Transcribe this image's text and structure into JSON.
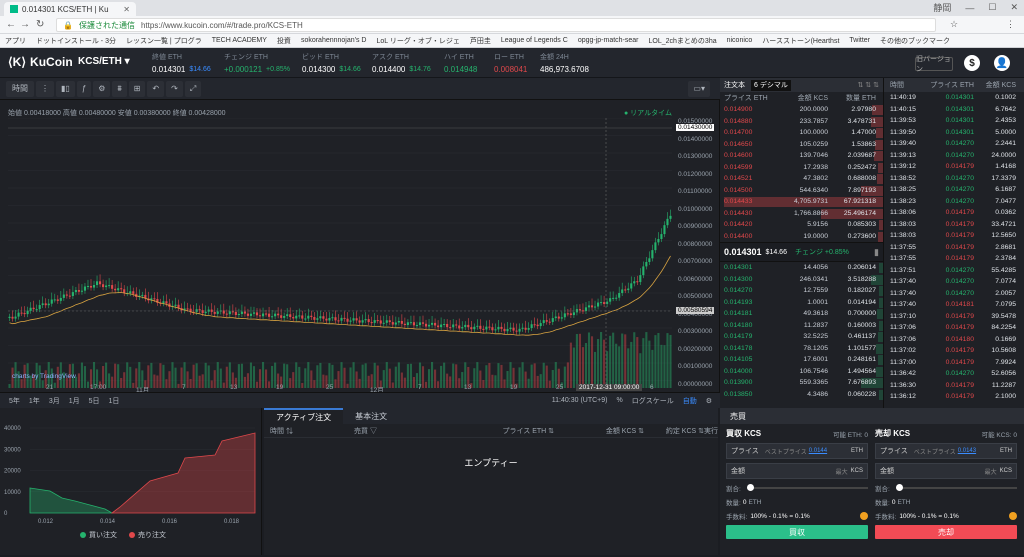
{
  "browser": {
    "tab_title": "0.014301 KCS/ETH | Ku",
    "user": "静岡",
    "url_secure": "保護された通信",
    "url": "https://www.kucoin.com/#/trade.pro/KCS-ETH",
    "bookmarks": [
      "アプリ",
      "ドットインストール - 3分",
      "レッスン一覧 | プログラ",
      "TECH ACADEMY",
      "投資",
      "sokorahennnojan's D",
      "LoL リーグ・オブ・レジェ",
      "芦田圭",
      "League of Legends C",
      "opgg-jp-match-sear",
      "LOL_2chまとめの3ha",
      "niconico",
      "ハースストーン(Hearthst",
      "Twitter",
      "その他のブックマーク"
    ]
  },
  "header": {
    "logo": "KuCoin",
    "pair": "KCS/ETH ▾",
    "stats": [
      {
        "label": "終値 ETH",
        "value": "0.014301",
        "sub": "$14.66"
      },
      {
        "label": "チェンジ ETH",
        "value": "+0.000121",
        "sub": "+0.85%"
      },
      {
        "label": "ビッド ETH",
        "value": "0.014300",
        "sub": "$14.66"
      },
      {
        "label": "アスク ETH",
        "value": "0.014400",
        "sub": "$14.76"
      },
      {
        "label": "ハイ ETH",
        "value": "0.014948",
        "sub": ""
      },
      {
        "label": "ロー ETH",
        "value": "0.008041",
        "sub": ""
      },
      {
        "label": "金額 24H",
        "value": "486,973.6708",
        "sub": ""
      }
    ],
    "lang_btn": "旧バージョン",
    "help": "$",
    "user": "👤"
  },
  "chart": {
    "toolbar_interval": "時間",
    "ohlc": "始値 0.00418000  高値 0.00480000  安値 0.00380000  終値 0.00428000",
    "realtime": "● リアルタイム",
    "price_tag": "0.01430000",
    "cross_tag": "0.00580594",
    "x_hl": "2017-12-31 09:00:00",
    "tradingview": "charts by TradingView",
    "yticks": [
      "0.01500000",
      "0.01400000",
      "0.01300000",
      "0.01200000",
      "0.01100000",
      "0.01000000",
      "0.00900000",
      "0.00800000",
      "0.00700000",
      "0.00600000",
      "0.00500000",
      "0.00400000",
      "0.00300000",
      "0.00200000",
      "0.00100000",
      "0.00000000"
    ],
    "xticks": [
      "21",
      "17:00",
      "11月",
      "7",
      "13",
      "19",
      "25",
      "12月",
      "7",
      "13",
      "19",
      "25",
      "6"
    ],
    "ranges": [
      "5年",
      "1年",
      "3月",
      "1月",
      "5日",
      "1日"
    ],
    "bottom_right": [
      "11:40:30 (UTC+9)",
      "%",
      "ログスケール",
      "自動"
    ]
  },
  "orderbook": {
    "title": "注文本",
    "decimal": "6 デシマル",
    "cols": [
      "プライス ETH",
      "金額 KCS",
      "数量 ETH"
    ],
    "asks": [
      [
        "0.014900",
        "200.0000",
        "2.97980"
      ],
      [
        "0.014880",
        "233.7857",
        "3.478731"
      ],
      [
        "0.014700",
        "100.0000",
        "1.47000"
      ],
      [
        "0.014650",
        "105.0259",
        "1.53863"
      ],
      [
        "0.014600",
        "139.7046",
        "2.039687"
      ],
      [
        "0.014599",
        "17.2938",
        "0.252472"
      ],
      [
        "0.014521",
        "47.3802",
        "0.688008"
      ],
      [
        "0.014500",
        "544.6340",
        "7.897193"
      ],
      [
        "0.014433",
        "4,705.9731",
        "67.921318"
      ],
      [
        "0.014430",
        "1,766.8866",
        "25.496174"
      ],
      [
        "0.014420",
        "5.9156",
        "0.085303"
      ],
      [
        "0.014400",
        "19.0000",
        "0.273600"
      ]
    ],
    "last": "0.014301",
    "last_usd": "$14.66",
    "change": "チェンジ +0.85%",
    "bids": [
      [
        "0.014301",
        "14.4056",
        "0.206014"
      ],
      [
        "0.014300",
        "246.0341",
        "3.518288"
      ],
      [
        "0.014270",
        "12.7559",
        "0.182027"
      ],
      [
        "0.014193",
        "1.0001",
        "0.014194"
      ],
      [
        "0.014181",
        "49.3618",
        "0.700000"
      ],
      [
        "0.014180",
        "11.2837",
        "0.160003"
      ],
      [
        "0.014179",
        "32.5225",
        "0.461137"
      ],
      [
        "0.014178",
        "78.1205",
        "1.101577"
      ],
      [
        "0.014105",
        "17.6001",
        "0.248161"
      ],
      [
        "0.014000",
        "106.7546",
        "1.494564"
      ],
      [
        "0.013900",
        "559.3365",
        "7.676893"
      ],
      [
        "0.013850",
        "4.3486",
        "0.060228"
      ]
    ]
  },
  "trades": {
    "cols": [
      "時間",
      "プライス ETH",
      "金額 KCS"
    ],
    "rows": [
      [
        "11:40:19",
        "0.014301",
        "0.1002"
      ],
      [
        "11:40:15",
        "0.014301",
        "6.7642"
      ],
      [
        "11:39:53",
        "0.014301",
        "2.4353"
      ],
      [
        "11:39:50",
        "0.014301",
        "5.0000"
      ],
      [
        "11:39:40",
        "0.014270",
        "2.2441"
      ],
      [
        "11:39:13",
        "0.014270",
        "24.0000"
      ],
      [
        "11:39:12",
        "0.014179",
        "1.4168"
      ],
      [
        "11:38:52",
        "0.014270",
        "17.3379"
      ],
      [
        "11:38:25",
        "0.014270",
        "6.1687"
      ],
      [
        "11:38:23",
        "0.014270",
        "7.0477"
      ],
      [
        "11:38:06",
        "0.014179",
        "0.0362"
      ],
      [
        "11:38:03",
        "0.014179",
        "33.4721"
      ],
      [
        "11:38:03",
        "0.014179",
        "12.5650"
      ],
      [
        "11:37:55",
        "0.014179",
        "2.8681"
      ],
      [
        "11:37:55",
        "0.014179",
        "2.3784"
      ],
      [
        "11:37:51",
        "0.014270",
        "55.4285"
      ],
      [
        "11:37:40",
        "0.014270",
        "7.0774"
      ],
      [
        "11:37:40",
        "0.014270",
        "2.0057"
      ],
      [
        "11:37:40",
        "0.014181",
        "7.0795"
      ],
      [
        "11:37:10",
        "0.014179",
        "39.5478"
      ],
      [
        "11:37:06",
        "0.014179",
        "84.2254"
      ],
      [
        "11:37:06",
        "0.014180",
        "0.1669"
      ],
      [
        "11:37:02",
        "0.014179",
        "10.5608"
      ],
      [
        "11:37:00",
        "0.014179",
        "7.9924"
      ],
      [
        "11:36:42",
        "0.014270",
        "52.6056"
      ],
      [
        "11:36:30",
        "0.014179",
        "11.2287"
      ],
      [
        "11:36:12",
        "0.014179",
        "2.1000"
      ]
    ]
  },
  "depth": {
    "legend_buy": "買い注文",
    "legend_sell": "売り注文",
    "xticks": [
      "0.012",
      "0.014",
      "0.016",
      "0.018"
    ],
    "yticks": [
      "40000",
      "30000",
      "20000",
      "10000",
      "0"
    ]
  },
  "active": {
    "tabs": [
      "アクティブ注文",
      "基本注文"
    ],
    "cols": [
      "時間 ⇅",
      "売買 ▽",
      "プライス ETH ⇅",
      "金額 KCS ⇅",
      "約定 KCS ⇅",
      "実行"
    ],
    "empty": "エンプティー"
  },
  "trade": {
    "title": "売買",
    "buy": {
      "head": "買収 KCS",
      "avail": "可能 ETH: 0",
      "price_label": "プライス",
      "best": "ベストプライス",
      "best_val": "0.0144",
      "unit": "ETH",
      "amount_label": "金額",
      "max": "最大",
      "unit2": "KCS",
      "ratio": "割合:",
      "qty": "数量:",
      "qty_val": "0",
      "qty_unit": "ETH",
      "fee": "手数料:",
      "fee_val": "100% - 0.1% = 0.1%",
      "btn": "買収"
    },
    "sell": {
      "head": "売却 KCS",
      "avail": "可能 KCS: 0",
      "price_label": "プライス",
      "best": "ベストプライス",
      "best_val": "0.0143",
      "unit": "ETH",
      "amount_label": "金額",
      "max": "最大",
      "unit2": "KCS",
      "ratio": "割合:",
      "qty": "数量:",
      "qty_val": "0",
      "qty_unit": "ETH",
      "fee": "手数料:",
      "fee_val": "100% - 0.1% = 0.1%",
      "btn": "売却"
    }
  },
  "colors": {
    "green": "#25b36d",
    "red": "#e0484b",
    "buy_btn": "#2bbf8a",
    "sell_btn": "#f24b55"
  }
}
